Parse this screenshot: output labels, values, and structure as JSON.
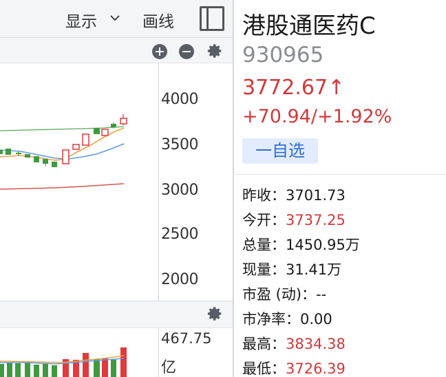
{
  "toolbar": {
    "show_label": "显示",
    "draw_label": "画线"
  },
  "price_axis": {
    "ticks": [
      "4000",
      "3500",
      "3000",
      "2500",
      "2000"
    ]
  },
  "volume_axis": {
    "max_label": "467.75",
    "unit_label": "亿"
  },
  "colors": {
    "up": "#e0393e",
    "down": "#3f9a3f",
    "ma_green": "#5aa35a",
    "ma_orange": "#f0a040",
    "ma_blue": "#5b9be8",
    "ma_red": "#d9534f",
    "accent_blue": "#2f6fd6"
  },
  "quote": {
    "name": "港股通医药C",
    "code": "930965",
    "price": "3772.67↑",
    "change": "+70.94/+1.92%",
    "watch_button": "一自选"
  },
  "stats": [
    {
      "label": "昨收：",
      "value": "3701.73",
      "color": "normal"
    },
    {
      "label": "今开：",
      "value": "3737.25",
      "color": "red"
    },
    {
      "label": "总量：",
      "value": "1450.95万",
      "color": "normal"
    },
    {
      "label": "现量：",
      "value": "31.41万",
      "color": "normal"
    },
    {
      "label": "市盈 (动)：",
      "value": "--",
      "color": "normal"
    },
    {
      "label": "市净率：",
      "value": "0.00",
      "color": "normal"
    },
    {
      "label": "最高：",
      "value": "3834.38",
      "color": "red"
    },
    {
      "label": "最低：",
      "value": "3726.39",
      "color": "red"
    }
  ]
}
